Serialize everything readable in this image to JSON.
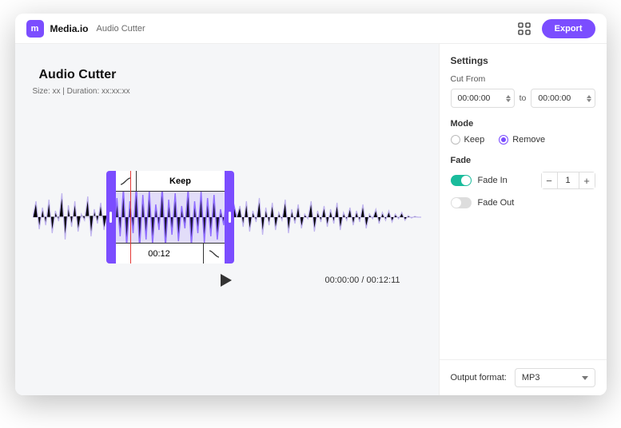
{
  "header": {
    "brand": "Media.io",
    "breadcrumb": "Audio Cutter",
    "export_label": "Export"
  },
  "main": {
    "title": "Audio Cutter",
    "meta": "Size: xx | Duration: xx:xx:xx",
    "selection_label": "Keep",
    "selection_time": "00:12",
    "current_time": "00:00:00",
    "total_time": "00:12:11"
  },
  "sidebar": {
    "settings_title": "Settings",
    "cut_from_label": "Cut From",
    "cut_from_start": "00:00:00",
    "to_label": "to",
    "cut_from_end": "00:00:00",
    "mode_label": "Mode",
    "mode_keep": "Keep",
    "mode_remove": "Remove",
    "mode_selected": "remove",
    "fade_label": "Fade",
    "fade_in_label": "Fade In",
    "fade_in_on": true,
    "fade_in_value": "1",
    "fade_out_label": "Fade Out",
    "fade_out_on": false,
    "output_label": "Output format:",
    "output_value": "MP3"
  },
  "colors": {
    "accent": "#7b4dff",
    "toggle_on": "#1abc9c"
  }
}
